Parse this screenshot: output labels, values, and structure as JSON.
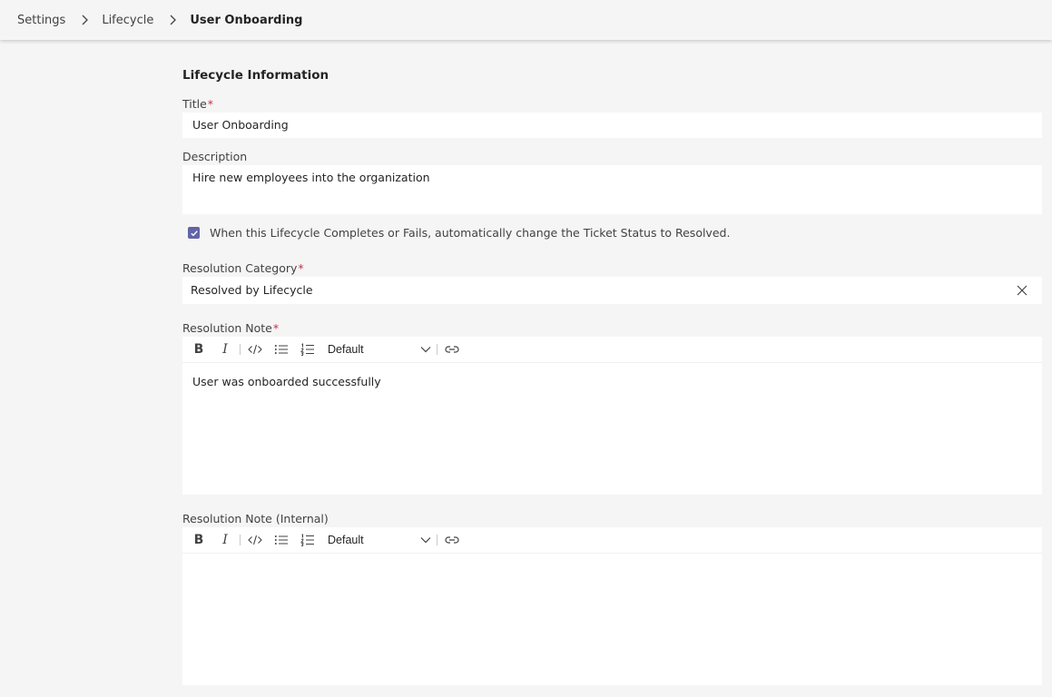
{
  "breadcrumb": {
    "items": [
      "Settings",
      "Lifecycle"
    ],
    "current": "User Onboarding"
  },
  "form": {
    "section_title": "Lifecycle Information",
    "title": {
      "label": "Title",
      "required_mark": "*",
      "value": "User Onboarding"
    },
    "description": {
      "label": "Description",
      "value": "Hire new employees into the organization"
    },
    "auto_resolve": {
      "checked": true,
      "label": "When this Lifecycle Completes or Fails, automatically change the Ticket Status to Resolved."
    },
    "resolution_category": {
      "label": "Resolution Category",
      "required_mark": "*",
      "value": "Resolved by Lifecycle"
    },
    "resolution_note": {
      "label": "Resolution Note",
      "required_mark": "*",
      "format_value": "Default",
      "value": "User was onboarded successfully"
    },
    "resolution_note_internal": {
      "label": "Resolution Note (Internal)",
      "format_value": "Default",
      "value": ""
    }
  },
  "colors": {
    "accent": "#6264a7",
    "required": "#c4314b",
    "background": "#f5f5f5"
  },
  "icons": [
    "chevron-right-icon",
    "checkmark-icon",
    "close-icon",
    "bold-icon",
    "italic-icon",
    "code-icon",
    "bulleted-list-icon",
    "numbered-list-icon",
    "chevron-down-icon",
    "link-icon"
  ]
}
